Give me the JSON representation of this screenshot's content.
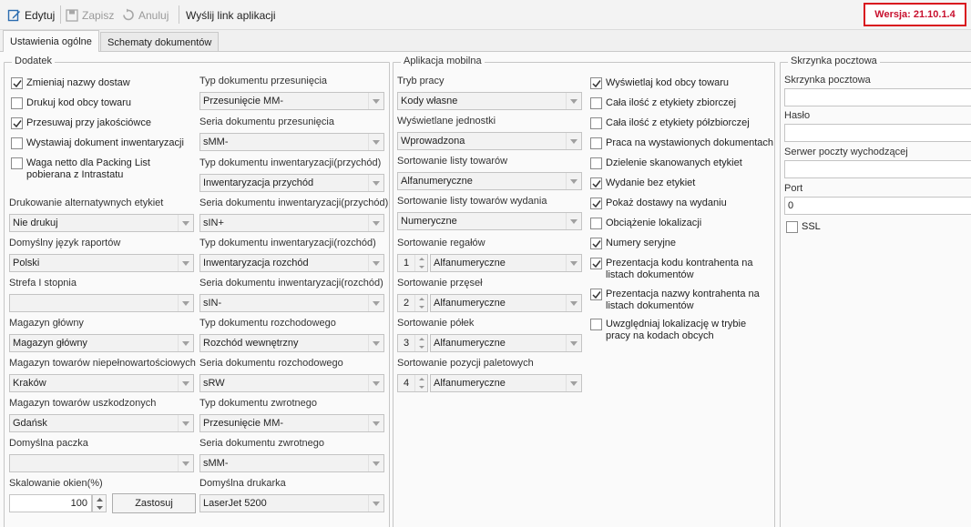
{
  "toolbar": {
    "edit_label": "Edytuj",
    "save_label": "Zapisz",
    "cancel_label": "Anuluj",
    "send_link_label": "Wyślij link aplikacji",
    "version": "Wersja: 21.10.1.4"
  },
  "tabs": [
    {
      "label": "Ustawienia ogólne",
      "active": true
    },
    {
      "label": "Schematy dokumentów",
      "active": false
    }
  ],
  "dodatek": {
    "title": "Dodatek",
    "checkboxes": [
      {
        "label": "Zmieniaj nazwy dostaw",
        "checked": true
      },
      {
        "label": "Drukuj kod obcy towaru",
        "checked": false
      },
      {
        "label": "Przesuwaj przy jakościówce",
        "checked": true
      },
      {
        "label": "Wystawiaj dokument inwentaryzacji",
        "checked": false
      },
      {
        "label": "Waga netto dla Packing List pobierana z Intrastatu",
        "checked": false
      }
    ],
    "left_fields": [
      {
        "label": "Drukowanie alternatywnych etykiet",
        "value": "Nie drukuj"
      },
      {
        "label": "Domyślny język raportów",
        "value": "Polski"
      },
      {
        "label": "Strefa I stopnia",
        "value": ""
      },
      {
        "label": "Magazyn główny",
        "value": "Magazyn główny"
      },
      {
        "label": "Magazyn towarów niepełnowartościowych",
        "value": "Kraków"
      },
      {
        "label": "Magazyn towarów uszkodzonych",
        "value": "Gdańsk"
      },
      {
        "label": "Domyślna paczka",
        "value": ""
      }
    ],
    "right_fields": [
      {
        "label": "Typ dokumentu przesunięcia",
        "value": "Przesunięcie MM-"
      },
      {
        "label": "Seria dokumentu przesunięcia",
        "value": "sMM-"
      },
      {
        "label": "Typ dokumentu inwentaryzacji(przychód)",
        "value": "Inwentaryzacja przychód"
      },
      {
        "label": "Seria dokumentu inwentaryzacji(przychód)",
        "value": "sIN+"
      },
      {
        "label": "Typ dokumentu inwentaryzacji(rozchód)",
        "value": "Inwentaryzacja rozchód"
      },
      {
        "label": "Seria dokumentu inwentaryzacji(rozchód)",
        "value": "sIN-"
      },
      {
        "label": "Typ dokumentu rozchodowego",
        "value": "Rozchód wewnętrzny"
      },
      {
        "label": "Seria dokumentu rozchodowego",
        "value": "sRW"
      },
      {
        "label": "Typ dokumentu zwrotnego",
        "value": "Przesunięcie MM-"
      },
      {
        "label": "Seria dokumentu zwrotnego",
        "value": "sMM-"
      },
      {
        "label": "Domyślna drukarka",
        "value": "LaserJet 5200"
      }
    ],
    "scaling_label": "Skalowanie okien(%)",
    "scaling_value": "100",
    "apply_label": "Zastosuj"
  },
  "mobile": {
    "title": "Aplikacja mobilna",
    "fields": [
      {
        "label": "Tryb pracy",
        "value": "Kody własne"
      },
      {
        "label": "Wyświetlane jednostki",
        "value": "Wprowadzona"
      },
      {
        "label": "Sortowanie listy towarów",
        "value": "Alfanumeryczne"
      },
      {
        "label": "Sortowanie listy towarów wydania",
        "value": "Numeryczne"
      }
    ],
    "sort_fields": [
      {
        "label": "Sortowanie regałów",
        "order": "1",
        "value": "Alfanumeryczne"
      },
      {
        "label": "Sortowanie przęseł",
        "order": "2",
        "value": "Alfanumeryczne"
      },
      {
        "label": "Sortowanie półek",
        "order": "3",
        "value": "Alfanumeryczne"
      },
      {
        "label": "Sortowanie pozycji paletowych",
        "order": "4",
        "value": "Alfanumeryczne"
      }
    ],
    "checkboxes": [
      {
        "label": "Wyświetlaj kod obcy towaru",
        "checked": true
      },
      {
        "label": "Cała ilość z etykiety zbiorczej",
        "checked": false
      },
      {
        "label": "Cała ilość z etykiety półzbiorczej",
        "checked": false
      },
      {
        "label": "Praca na wystawionych dokumentach",
        "checked": false
      },
      {
        "label": "Dzielenie skanowanych etykiet",
        "checked": false
      },
      {
        "label": "Wydanie bez etykiet",
        "checked": true
      },
      {
        "label": "Pokaż dostawy na wydaniu",
        "checked": true
      },
      {
        "label": "Obciążenie lokalizacji",
        "checked": false
      },
      {
        "label": "Numery seryjne",
        "checked": true
      },
      {
        "label": "Prezentacja kodu kontrahenta na listach dokumentów",
        "checked": true
      },
      {
        "label": "Prezentacja nazwy kontrahenta na listach dokumentów",
        "checked": true
      },
      {
        "label": "Uwzględniaj lokalizację w trybie pracy na kodach obcych",
        "checked": false
      }
    ]
  },
  "mailbox": {
    "title": "Skrzynka pocztowa",
    "mailbox_label": "Skrzynka pocztowa",
    "mailbox_value": "",
    "password_label": "Hasło",
    "password_value": "",
    "smtp_label": "Serwer poczty wychodzącej",
    "smtp_value": "",
    "port_label": "Port",
    "port_value": "0",
    "ssl_label": "SSL",
    "ssl_checked": false
  }
}
